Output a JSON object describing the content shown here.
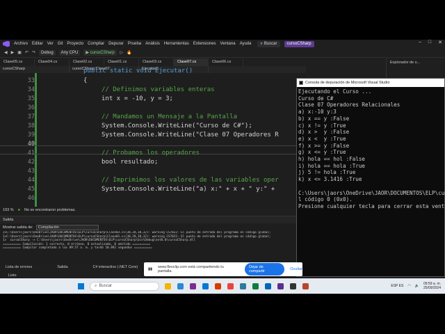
{
  "menubar": {
    "items": [
      "Archivo",
      "Editar",
      "Ver",
      "Git",
      "Proyecto",
      "Compilar",
      "Depurar",
      "Prueba",
      "Análisis",
      "Herramientas",
      "Extensiones",
      "Ventana",
      "Ayuda"
    ],
    "search": "Buscar",
    "project": "cursoCSharp"
  },
  "toolbar": {
    "config": "Debug",
    "platform": "Any CPU",
    "run": "cursoCSharp"
  },
  "tabs": [
    "Clase05.cs",
    "Clase04.cs",
    "Clase02.cs",
    "Clase01.cs",
    "Clase03.cs",
    "Clase07.cs",
    "Clase06.cs"
  ],
  "explorer": {
    "title": "Explorador de s..."
  },
  "navbar": {
    "project": "cursoCSharp",
    "class": "cursoCSharp.Clase07",
    "member": "Ejecutar()"
  },
  "editor": {
    "partial_top": "public static void Ejecutar()",
    "lines": [
      {
        "n": "33",
        "text": "{"
      },
      {
        "n": "34",
        "text": "// Definimos variables enteras"
      },
      {
        "n": "35",
        "text": "int x = -10, y = 3;"
      },
      {
        "n": "36",
        "text": ""
      },
      {
        "n": "37",
        "text": "// Mandamos un Mensaje a la Pantalla"
      },
      {
        "n": "38",
        "text": "System.Console.WriteLine(\"Curso de C#\");"
      },
      {
        "n": "39",
        "text": "System.Console.WriteLine(\"Clase 07 Operadores R"
      },
      {
        "n": "40",
        "text": ""
      },
      {
        "n": "41",
        "text": "// Probamos los operadores"
      },
      {
        "n": "42",
        "text": "bool resultado;"
      },
      {
        "n": "43",
        "text": ""
      },
      {
        "n": "44",
        "text": "// Imprimimos los valores de las variables oper"
      },
      {
        "n": "45",
        "text": "System.Console.WriteLine(\"a) x:\" + x + \" y:\" +"
      },
      {
        "n": "46",
        "text": ""
      }
    ],
    "zoom": "193 %",
    "status": "No se encontraron problemas."
  },
  "output": {
    "title": "Salida",
    "show_label": "Mostrar salida de:",
    "source": "Compilación",
    "lines": [
      "1>C:\\Users\\jaors\\OneDrive\\JAOR\\DOCUMENTOS\\ELP\\cursoCSharp\\Clase03.cs(38,28,38,32): warning CS7022: El punto de entrada del programa es código global;",
      "1>C:\\Users\\jaors\\OneDrive\\JAOR\\DOCUMENTOS\\ELP\\cursoCSharp\\Clase01.cs(38,28,38,32): warning CS7022: El punto de entrada del programa es código global;",
      "1>  cursoCSharp -> C:\\Users\\jaors\\OneDrive\\JAOR\\DOCUMENTOS\\ELP\\cursoCSharp\\bin\\Debug\\net8.0\\cursoCSharp.dll",
      "========== Compilación: 1 correcto, 0 erróneo, 0 actualizado, 0 omitido ==========",
      "========== Compilar completado a las 09:57 a. m. y tardó 10.892 segundos =========="
    ]
  },
  "bottom_tabs": [
    "Lista de errores",
    "Salida",
    "C# interactivo (.NET Core)"
  ],
  "status_bar": "Listo",
  "console": {
    "title": "Consola de depuración de Microsoft Visual Studio",
    "lines": [
      "Ejecutando el Curso ...",
      "Curso de C#",
      "Clase 07 Operadores Relacionales",
      "a) x:-10 y:3",
      "b) x == y :False",
      "c) x != y :True",
      "d) x >  y :False",
      "e) x <  y :True",
      "f) x >= y :False",
      "g) x <= y :True",
      "h) hola == hol :False",
      "i) hola == hola :True",
      "j) 5 != hola :True",
      "k) x <= 3.1416 :True",
      "",
      "C:\\Users\\jaors\\OneDrive\\JAOR\\DOCUMENTOS\\ELP\\curs",
      "l código 0 (0x0).",
      "Presione cualquier tecla para cerrar esta ventan"
    ]
  },
  "share": {
    "text": "www.flexclip.com está compartiendo tu pantalla.",
    "stop": "Dejar de compartir",
    "hide": "Ocultar"
  },
  "taskbar": {
    "search": "Buscar",
    "lang": "ESP ES",
    "time": "09:59 a. m.",
    "date": "25/09/2024"
  }
}
